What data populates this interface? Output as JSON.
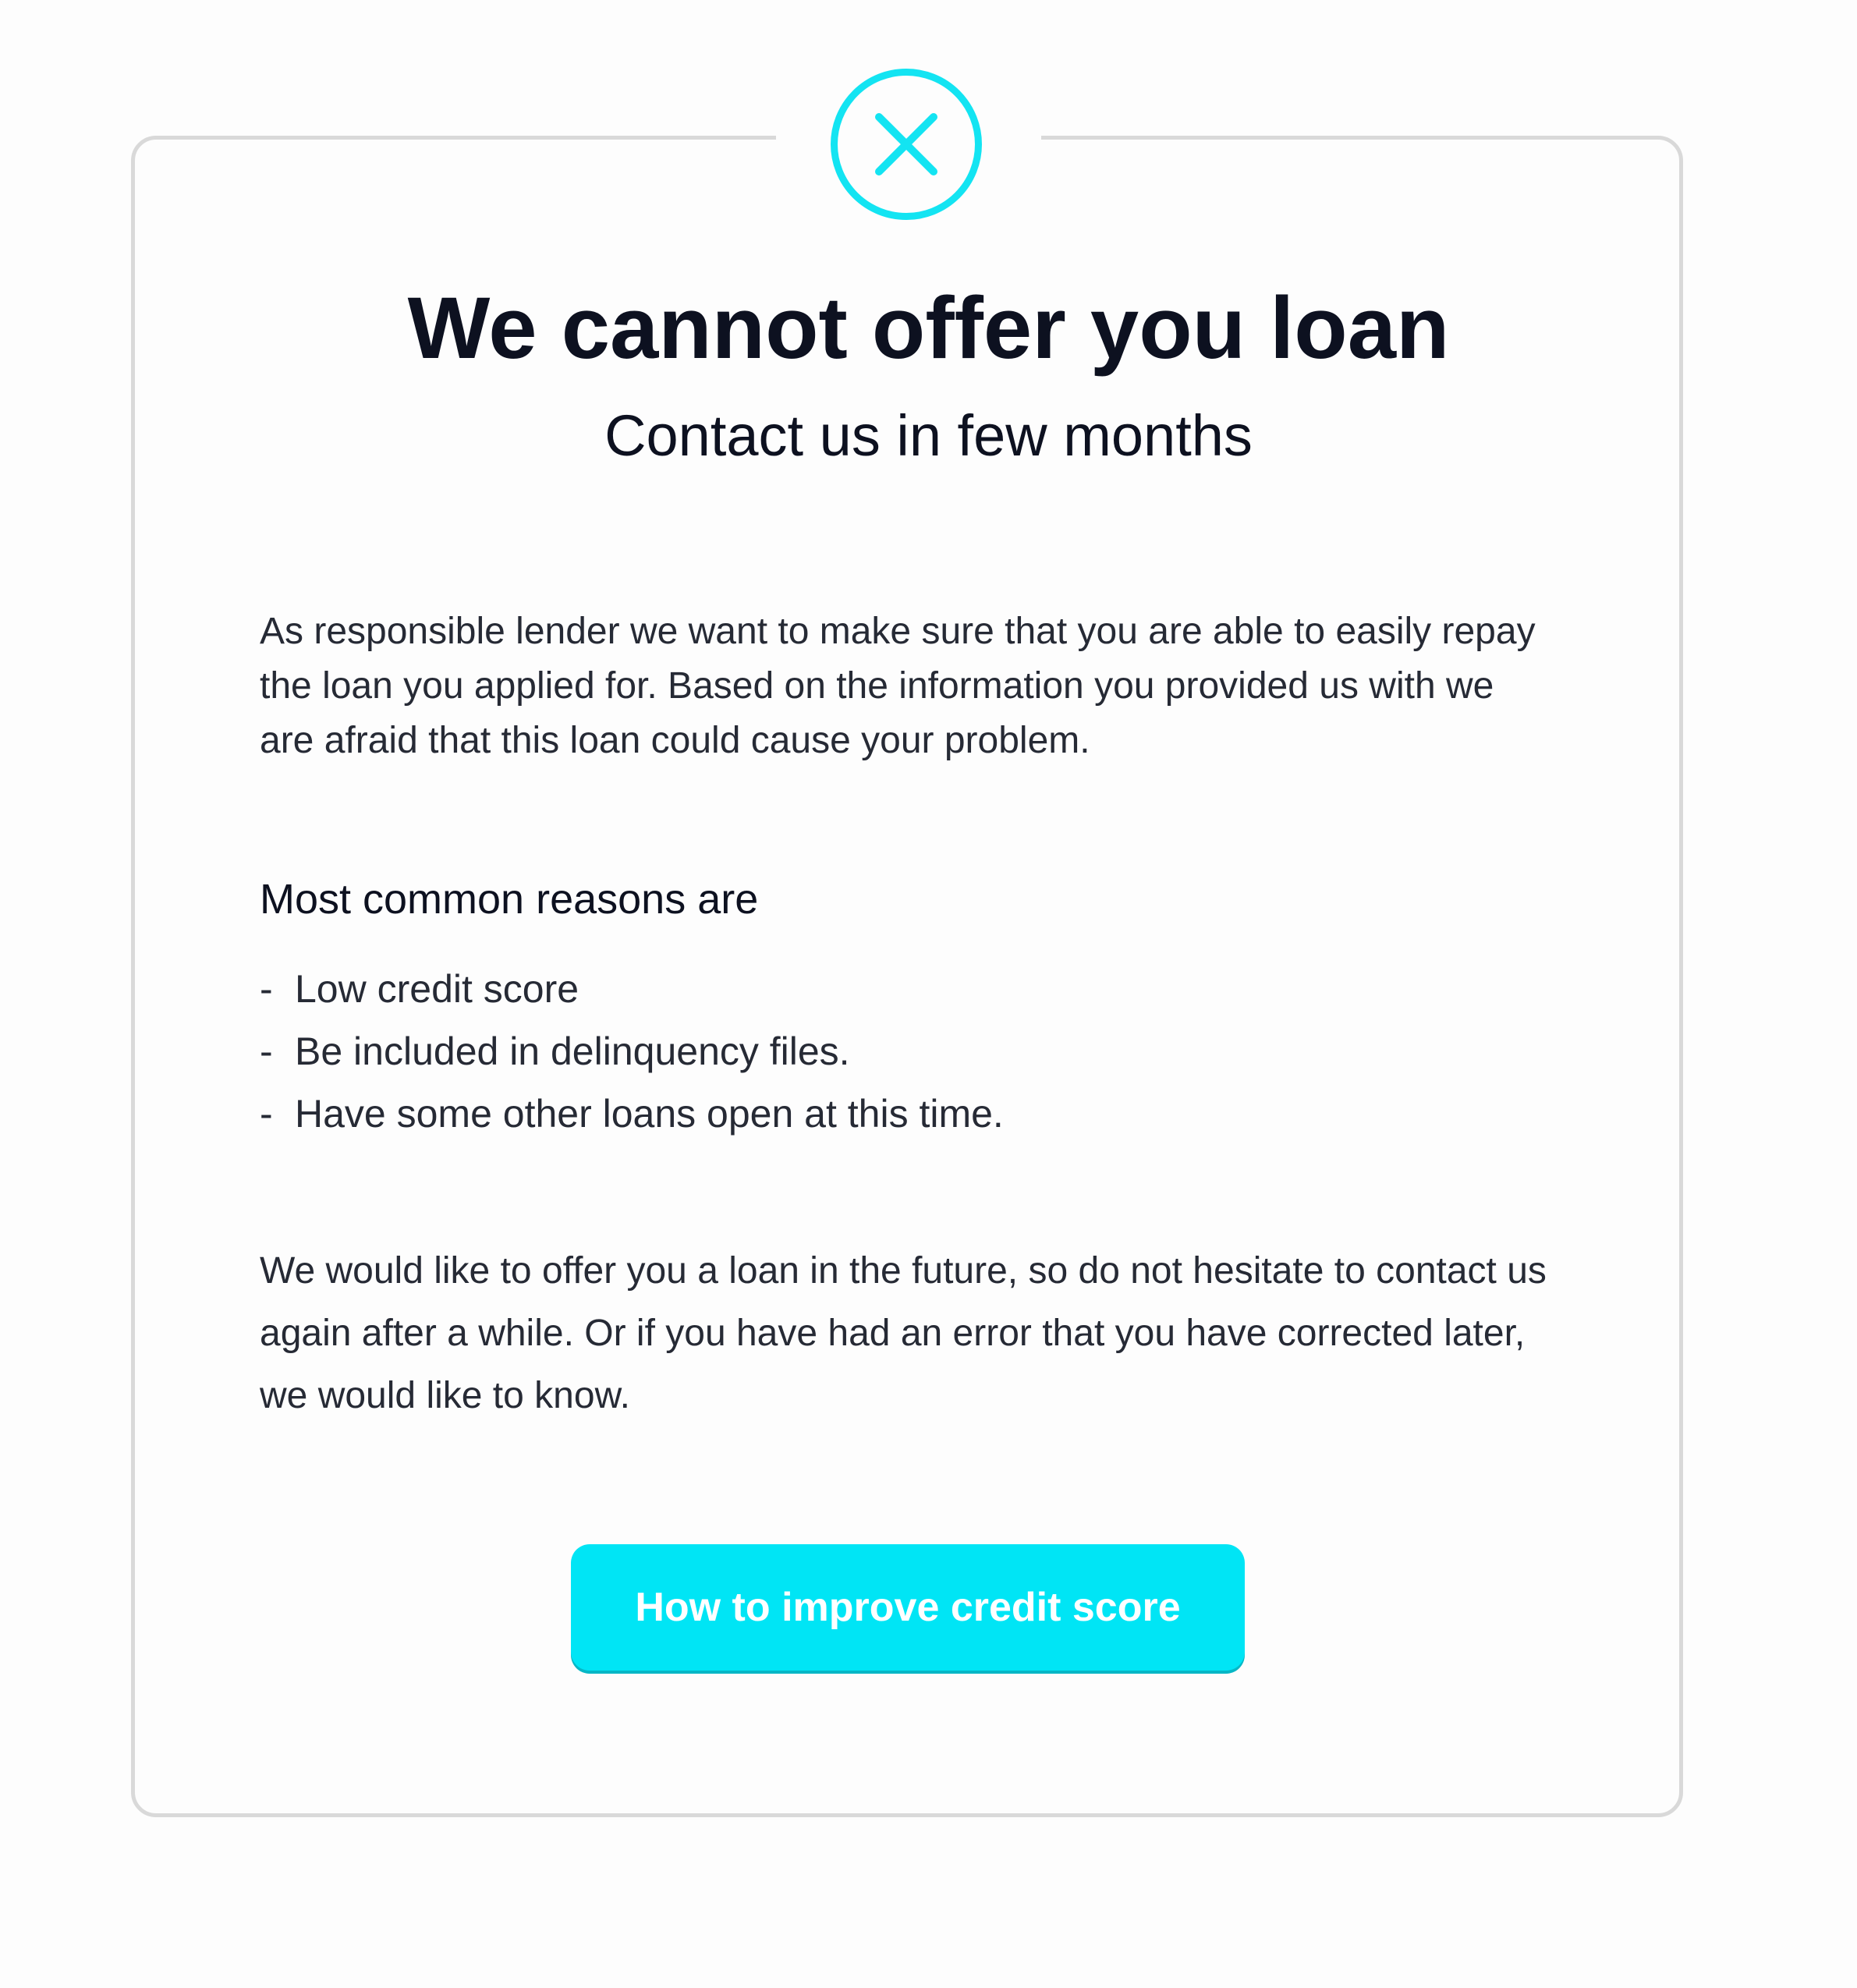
{
  "dialog": {
    "icon": "close-circle-icon",
    "accent_color": "#00e5f5",
    "title": "We cannot offer you loan",
    "subtitle": "Contact us in few months",
    "intro": "As responsible lender we want to make sure that you are able to easily repay the loan you applied for. Based on the information you provided us with we are afraid that this loan could cause your problem.",
    "reasons_heading": "Most common reasons are",
    "reasons": [
      "Low credit score",
      "Be included in delinquency files.",
      "Have some other loans open at this time."
    ],
    "closing": "We would like to offer you a loan in the future, so do not hesitate to contact us again after a while. Or if you have had an error that you have corrected later, we would like to know.",
    "cta_label": "How to improve credit score"
  }
}
